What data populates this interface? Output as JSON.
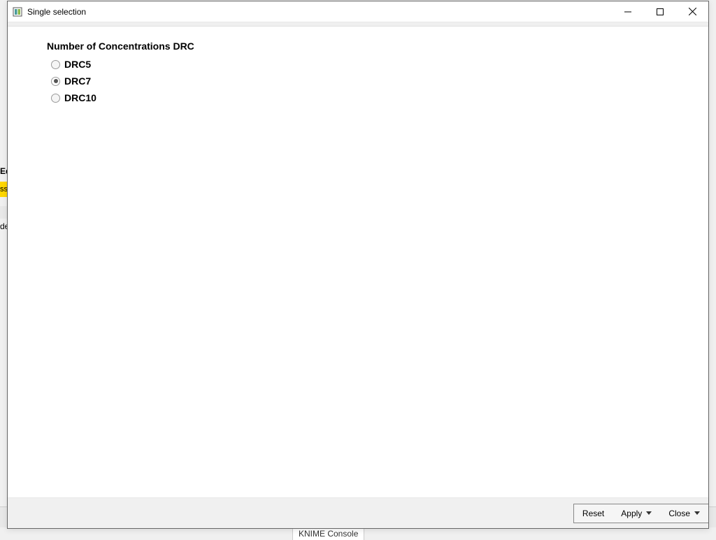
{
  "titlebar": {
    "title": "Single selection"
  },
  "form": {
    "group_label": "Number of Concentrations DRC",
    "options": [
      {
        "label": "DRC5",
        "selected": false
      },
      {
        "label": "DRC7",
        "selected": true
      },
      {
        "label": "DRC10",
        "selected": false
      }
    ]
  },
  "buttons": {
    "reset": "Reset",
    "apply": "Apply",
    "close": "Close"
  },
  "background": {
    "partial_text_1": "Ed",
    "partial_text_highlight": "ss",
    "partial_text_2": "de",
    "console_tab": "KNIME Console"
  }
}
